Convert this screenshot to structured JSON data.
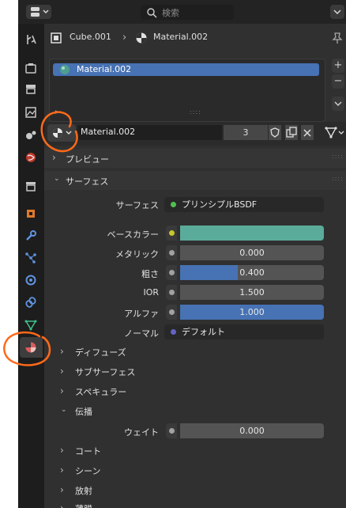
{
  "header": {
    "search_placeholder": "検索"
  },
  "breadcrumb": {
    "object": "Cube.001",
    "material": "Material.002"
  },
  "slots": {
    "items": [
      {
        "label": "Material.002"
      }
    ]
  },
  "material_bar": {
    "name": "Material.002",
    "users": "3"
  },
  "panels": {
    "preview": "プレビュー",
    "surface": "サーフェス",
    "diffuse": "ディフューズ",
    "subsurface": "サブサーフェス",
    "specular": "スペキュラー",
    "transmission": "伝播",
    "coat": "コート",
    "sheen": "シーン",
    "emission": "放射",
    "thin_film": "薄膜"
  },
  "surface": {
    "surface_label": "サーフェス",
    "surface_value": "プリンシプルBSDF",
    "base_color_label": "ベースカラー",
    "metallic_label": "メタリック",
    "metallic_value": "0.000",
    "roughness_label": "粗さ",
    "roughness_value": "0.400",
    "roughness_fraction": 0.4,
    "ior_label": "IOR",
    "ior_value": "1.500",
    "alpha_label": "アルファ",
    "alpha_value": "1.000",
    "alpha_fraction": 1.0,
    "normal_label": "ノーマル",
    "normal_value": "デフォルト"
  },
  "transmission": {
    "weight_label": "ウェイト",
    "weight_value": "0.000"
  },
  "colors": {
    "accent": "#4772b3",
    "base_color": "#5bab9a",
    "shader_socket": "#4fc04f",
    "color_socket": "#c7c729",
    "value_socket": "#a1a1a1",
    "vector_socket": "#6363c7",
    "annotation": "#ff6a1a"
  },
  "icons": [
    "editor-type-icon",
    "search-icon",
    "tool-icon",
    "render-icon",
    "output-icon",
    "view-layer-icon",
    "scene-icon",
    "world-icon",
    "collection-icon",
    "object-icon",
    "modifier-icon",
    "particles-icon",
    "physics-icon",
    "constraints-icon",
    "data-icon",
    "material-icon",
    "pin-icon",
    "node-tree-icon"
  ]
}
